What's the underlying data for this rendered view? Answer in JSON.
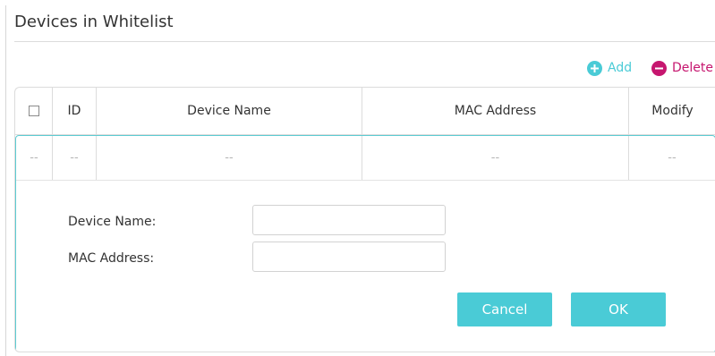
{
  "section": {
    "title": "Devices in Whitelist"
  },
  "toolbar": {
    "add_label": "Add",
    "delete_label": "Delete"
  },
  "table": {
    "columns": [
      "ID",
      "Device Name",
      "MAC Address",
      "Modify"
    ],
    "rows": [
      {
        "checkbox": "--",
        "id": "--",
        "device_name": "--",
        "mac_address": "--",
        "modify": "--"
      }
    ]
  },
  "form": {
    "device_name_label": "Device Name:",
    "device_name_value": "",
    "mac_address_label": "MAC Address:",
    "mac_address_value": "",
    "cancel_label": "Cancel",
    "ok_label": "OK"
  },
  "colors": {
    "accent": "#4acbd6",
    "delete": "#c6166f",
    "edit_border": "#5ccbd2"
  },
  "icons": {
    "add": "plus-circle-icon",
    "delete": "minus-circle-icon"
  }
}
